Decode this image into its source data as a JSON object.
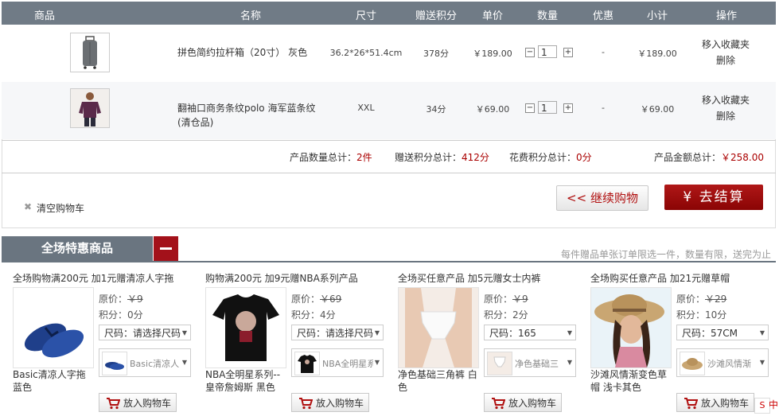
{
  "header": {
    "col_goods": "商品",
    "col_name": "名称",
    "col_size": "尺寸",
    "col_points": "赠送积分",
    "col_price": "单价",
    "col_qty": "数量",
    "col_discount": "优惠",
    "col_subtotal": "小计",
    "col_ops": "操作"
  },
  "items": [
    {
      "name": "拼色简约拉杆箱（20寸） 灰色",
      "size": "36.2*26*51.4cm",
      "points": "378分",
      "price": "￥189.00",
      "qty": "1",
      "discount": "-",
      "subtotal": "￥189.00",
      "op_fav": "移入收藏夹",
      "op_del": "删除",
      "image_icon": "luggage-image"
    },
    {
      "name_line1": "翻袖口商务条纹polo 海军蓝条纹",
      "name_line2": "(清仓品)",
      "size": "XXL",
      "points": "34分",
      "price": "￥69.00",
      "qty": "1",
      "discount": "-",
      "subtotal": "￥69.00",
      "op_fav": "移入收藏夹",
      "op_del": "删除",
      "image_icon": "polo-shirt-image"
    }
  ],
  "totals": {
    "count_label": "产品数量总计：",
    "count_value": "2件",
    "points_label": "赠送积分总计：",
    "points_value": "412分",
    "spent_label": "花费积分总计：",
    "spent_value": "0分",
    "amount_label": "产品金额总计：",
    "amount_value": "￥258.00"
  },
  "actions": {
    "clear_cart": "清空购物车",
    "continue": "<< 继续购物",
    "checkout": "¥ 去结算"
  },
  "promo": {
    "title": "全场特惠商品",
    "note": "每件赠品单张订单限选一件，数量有限，送完为止",
    "cards": [
      {
        "title": "全场购物满200元 加1元赠清凉人字拖",
        "orig_label": "原价：",
        "orig_value": "￥9",
        "points": "积分：0分",
        "size_select": "尺码：请选择尺码",
        "variant": "Basic清凉人",
        "name": "Basic清凉人字拖 蓝色",
        "add": "放入购物车"
      },
      {
        "title": "购物满200元 加9元赠NBA系列产品",
        "orig_label": "原价：",
        "orig_value": "￥69",
        "points": "积分：4分",
        "size_select": "尺码：请选择尺码",
        "variant": "NBA全明星系",
        "name": "NBA全明星系列--皇帝詹姆斯 黑色",
        "add": "放入购物车"
      },
      {
        "title": "全场买任意产品 加5元赠女士内裤",
        "orig_label": "原价：",
        "orig_value": "￥9",
        "points": "积分：2分",
        "size_select": "尺码：165",
        "variant": "净色基础三",
        "name": "净色基础三角裤 白色",
        "add": "放入购物车"
      },
      {
        "title": "全场购买任意产品 加21元赠草帽",
        "orig_label": "原价：",
        "orig_value": "￥29",
        "points": "积分：10分",
        "size_select": "尺码：57CM",
        "variant": "沙滩风情渐",
        "name": "沙滩风情渐变色草帽 浅卡其色",
        "add": "放入购物车"
      }
    ]
  },
  "ime": {
    "logo": "S",
    "mode": "中"
  }
}
